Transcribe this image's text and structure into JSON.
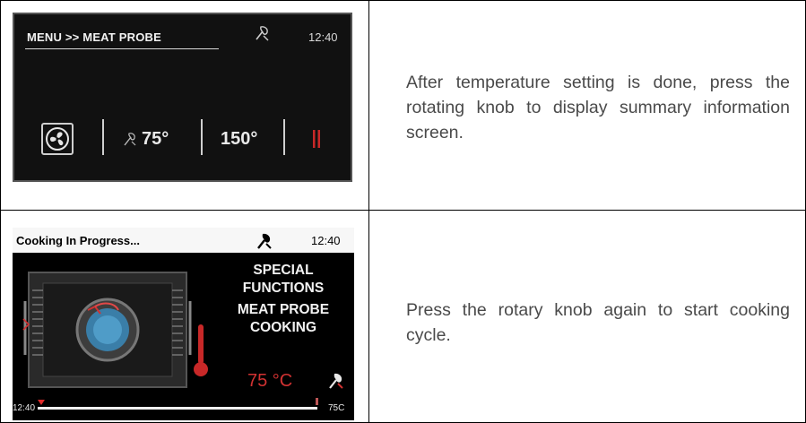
{
  "rows": [
    {
      "screen": {
        "header": "MENU >> MEAT PROBE",
        "time": "12:40",
        "probe_temp": "75°",
        "oven_temp": "150°",
        "icons": [
          "meat-probe-icon",
          "fan-icon",
          "pause-icon"
        ]
      },
      "description": "After temperature setting is done, press the rotating knob to display summary information screen."
    },
    {
      "screen": {
        "header": "Cooking In Progress...",
        "time": "12:40",
        "lines": [
          "SPECIAL",
          "FUNCTIONS",
          "MEAT PROBE",
          "COOKING"
        ],
        "probe_temp": "75 °C",
        "start_time": "12:40",
        "end_temp": "75C",
        "icons": [
          "meat-probe-icon",
          "oven-cavity-icon",
          "thermometer-icon"
        ],
        "accent_color": "#d23232"
      },
      "description": "Press the rotary knob again to start cooking cycle."
    }
  ]
}
